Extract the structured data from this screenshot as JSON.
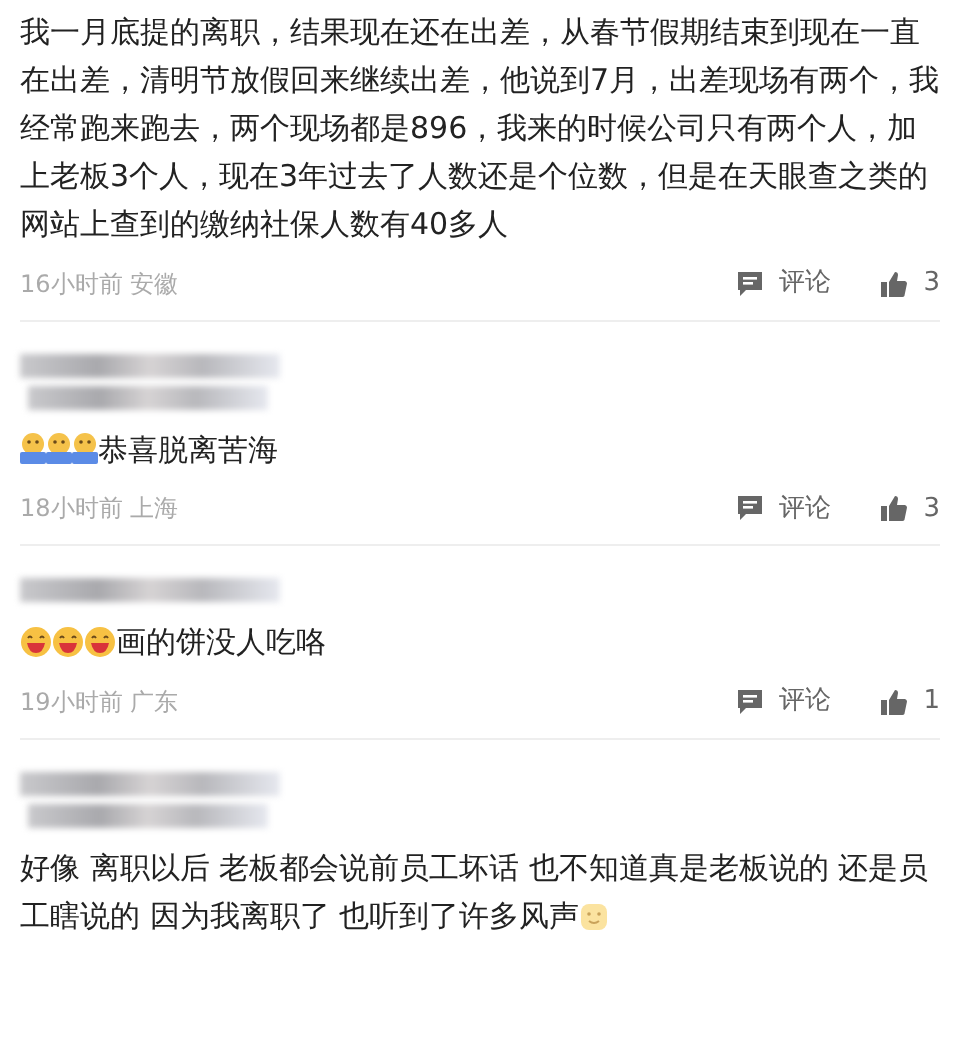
{
  "comments": [
    {
      "body": [
        {
          "kind": "text",
          "text": "我一月底提的离职，结果现在还在出差，从春节假期结束到现在一直在出差，清明节放假回来继续出差，他说到7月，出差现场有两个，我经常跑来跑去，两个现场都是896，我来的时候公司只有两个人，加上老板3个人，现在3年过去了人数还是个位数，但是在天眼查之类的网站上查到的缴纳社保人数有40多人"
        }
      ],
      "footer": {
        "time": "16小时前",
        "location": "安徽",
        "reply_label": "评论",
        "likes": "3"
      }
    },
    {
      "author_blur": [
        {
          "kind": "name"
        },
        {
          "kind": "subtitle"
        }
      ],
      "body": [
        {
          "kind": "banner_emoji"
        },
        {
          "kind": "banner_emoji"
        },
        {
          "kind": "banner_emoji"
        },
        {
          "kind": "text",
          "text": "恭喜脱离苦海"
        }
      ],
      "footer": {
        "time": "18小时前",
        "location": "上海",
        "reply_label": "评论",
        "likes": "3"
      }
    },
    {
      "author_blur": [
        {
          "kind": "name"
        }
      ],
      "body": [
        {
          "kind": "laugh_emoji"
        },
        {
          "kind": "laugh_emoji"
        },
        {
          "kind": "laugh_emoji"
        },
        {
          "kind": "text",
          "text": "画的饼没人吃咯"
        }
      ],
      "footer": {
        "time": "19小时前",
        "location": "广东",
        "reply_label": "评论",
        "likes": "1"
      }
    },
    {
      "author_blur": [
        {
          "kind": "name"
        },
        {
          "kind": "subtitle"
        }
      ],
      "body": [
        {
          "kind": "text",
          "text": "好像 离职以后 老板都会说前员工坏话 也不知道真是老板说的 还是员工瞎说的 因为我离职了 也听到了许多风声"
        },
        {
          "kind": "pale_emoji"
        }
      ]
    }
  ]
}
